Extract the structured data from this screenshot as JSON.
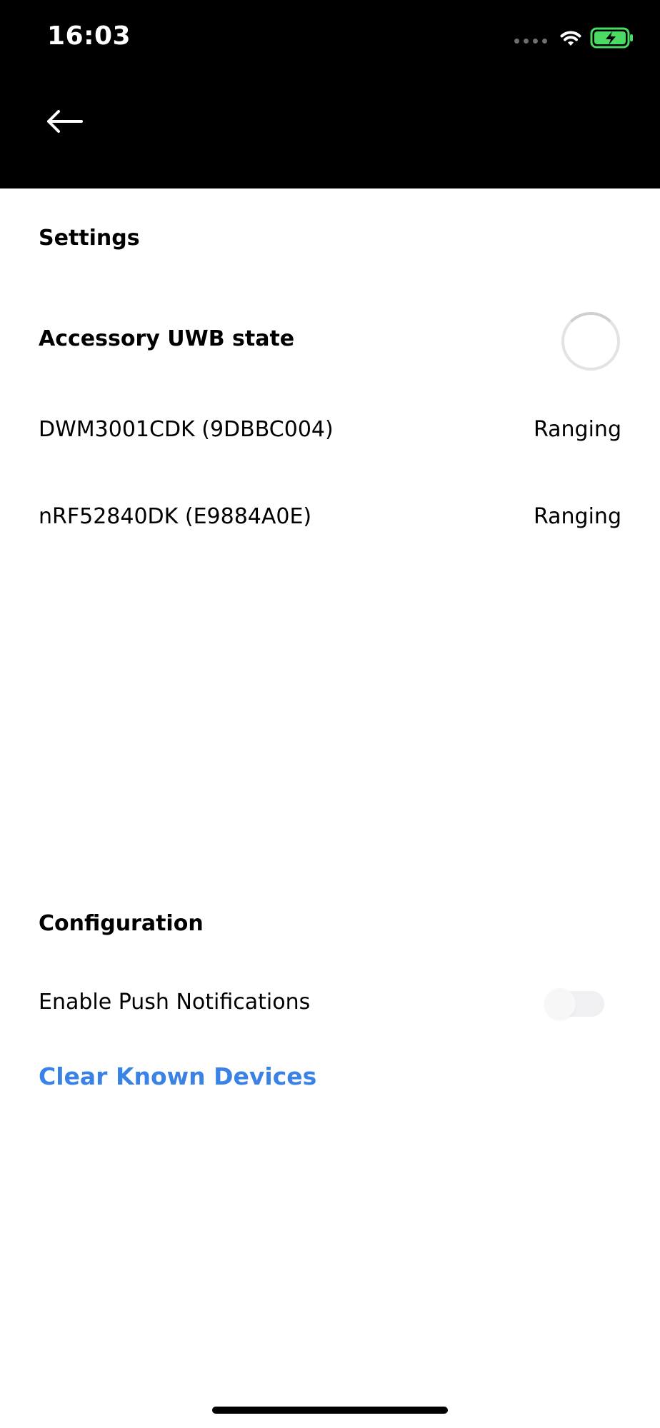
{
  "status_bar": {
    "time": "16:03"
  },
  "header": {
    "back_icon": "arrow-left-icon"
  },
  "settings": {
    "title": "Settings",
    "uwb_state_label": "Accessory UWB state",
    "devices": [
      {
        "name": "DWM3001CDK (9DBBC004)",
        "status": "Ranging"
      },
      {
        "name": "nRF52840DK (E9884A0E)",
        "status": "Ranging"
      }
    ]
  },
  "configuration": {
    "title": "Configuration",
    "push_label": "Enable Push Notifications",
    "push_enabled": false,
    "clear_label": "Clear Known Devices"
  },
  "colors": {
    "header_bg": "#000000",
    "link": "#3b82e6",
    "battery_fill": "#4cd964"
  }
}
